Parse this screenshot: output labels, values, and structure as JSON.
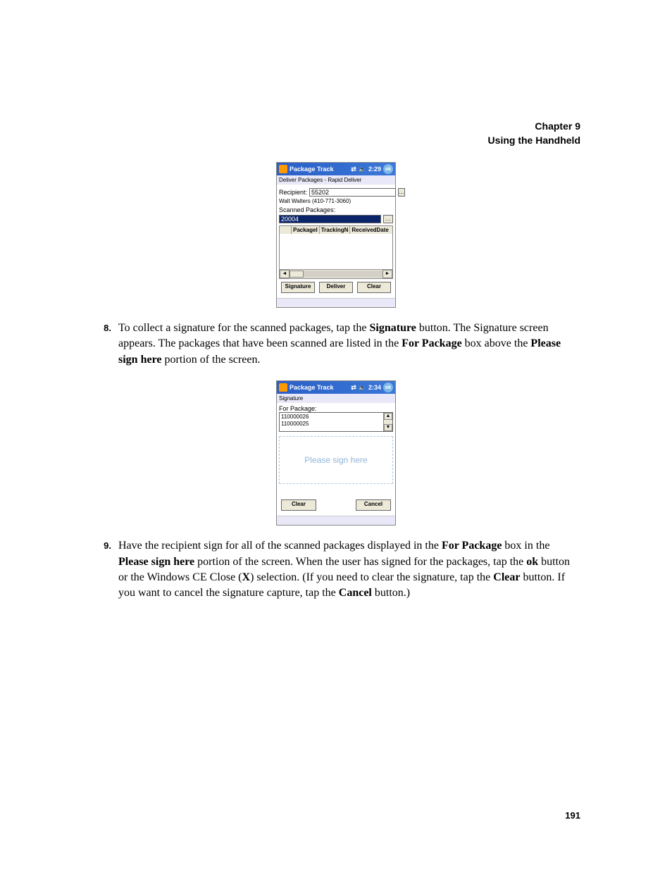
{
  "header": {
    "line1": "Chapter 9",
    "line2": "Using the Handheld"
  },
  "page_number": "191",
  "steps": {
    "s8": {
      "num": "8.",
      "html": "To collect a signature for the scanned packages, tap the <b>Signature</b> button. The Signature screen appears. The packages that have been scanned are listed in the <b>For Package</b> box above the <b>Please sign here</b> portion of the screen."
    },
    "s9": {
      "num": "9.",
      "html": "Have the recipient sign for all of the scanned packages displayed in the <b>For Package</b> box in the <b>Please sign here</b> portion of the screen. When the user has signed for the packages, tap the <b>ok</b> button or the Windows CE Close (<b>X</b>) selection. (If you need to clear the signature, tap the <b>Clear</b> button. If you want to cancel the signature capture, tap the <b>Cancel</b> button.)"
    }
  },
  "device1": {
    "title": "Package Track",
    "time": "2:29",
    "ok": "ok",
    "subtitle": "Deliver Packages - Rapid Deliver",
    "recipient_label": "Recipient:",
    "recipient_value": "55202",
    "recipient_name": "Walt Walters (410-771-3060)",
    "scanned_label": "Scanned Packages:",
    "scan_value": "20004",
    "columns": [
      "PackageI",
      "TrackingN",
      "ReceivedDate"
    ],
    "buttons": {
      "signature": "Signature",
      "deliver": "Deliver",
      "clear": "Clear"
    }
  },
  "device2": {
    "title": "Package Track",
    "time": "2:34",
    "ok": "ok",
    "subtitle": "Signature",
    "for_package_label": "For Package:",
    "packages": [
      "110000026",
      "110000025"
    ],
    "placeholder": "Please sign here",
    "buttons": {
      "clear": "Clear",
      "cancel": "Cancel"
    }
  }
}
